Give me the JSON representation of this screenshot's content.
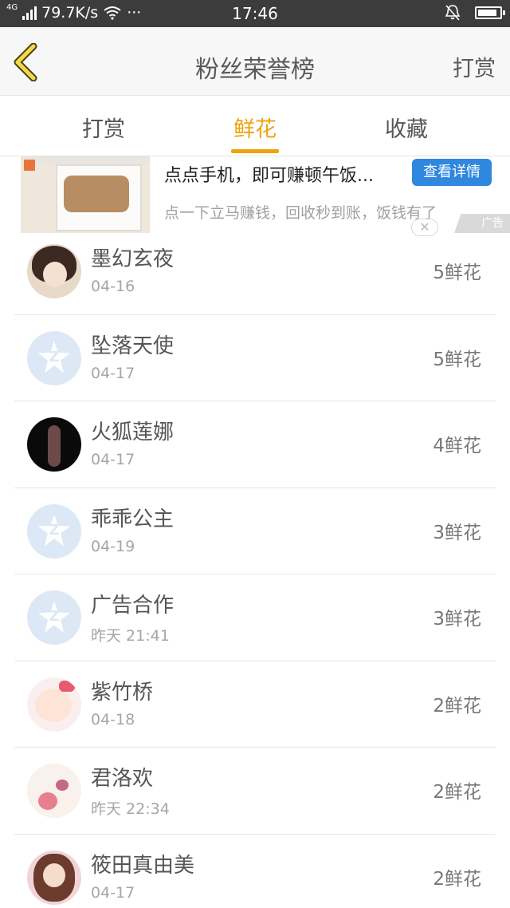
{
  "status_bar": {
    "network": "4G",
    "speed": "79.7K/s",
    "dots": "···",
    "time": "17:46",
    "battery_level": 0.9
  },
  "header": {
    "title": "粉丝荣誉榜",
    "right_label": "打赏"
  },
  "tabs": [
    {
      "label": "打赏",
      "active": false
    },
    {
      "label": "鲜花",
      "active": true
    },
    {
      "label": "收藏",
      "active": false
    }
  ],
  "ad": {
    "title": "点点手机，即可赚顿午饭...",
    "button": "查看详情",
    "description": "点一下立马赚钱，回收秒到账，饭钱有了",
    "close": "✕",
    "badge": "广告"
  },
  "list": [
    {
      "name": "墨幻玄夜",
      "date": "04-16",
      "count": "5鲜花",
      "avatar": "girl-portrait"
    },
    {
      "name": "坠落天使",
      "date": "04-17",
      "count": "5鲜花",
      "avatar": "default-qzone"
    },
    {
      "name": "火狐莲娜",
      "date": "04-17",
      "count": "4鲜花",
      "avatar": "dark-figure"
    },
    {
      "name": "乖乖公主",
      "date": "04-19",
      "count": "3鲜花",
      "avatar": "default-qzone"
    },
    {
      "name": "广告合作",
      "date": "昨天 21:41",
      "count": "3鲜花",
      "avatar": "default-qzone"
    },
    {
      "name": "紫竹桥",
      "date": "04-18",
      "count": "2鲜花",
      "avatar": "cartoon-bow"
    },
    {
      "name": "君洛欢",
      "date": "昨天 22:34",
      "count": "2鲜花",
      "avatar": "flower-calligraphy"
    },
    {
      "name": "筱田真由美",
      "date": "04-17",
      "count": "2鲜花",
      "avatar": "doll-portrait"
    }
  ],
  "colors": {
    "accent": "#f0a30a",
    "ad_button": "#2f87e0",
    "status_bar": "#3c3c3c"
  }
}
